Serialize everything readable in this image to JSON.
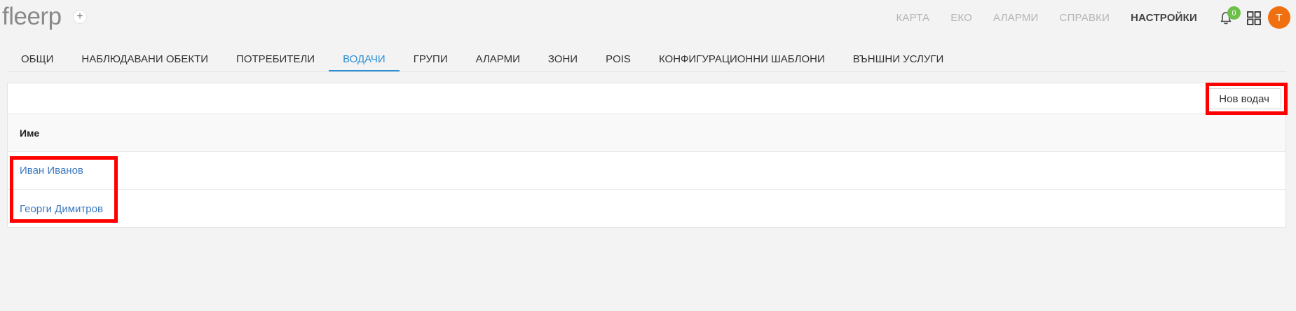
{
  "app": {
    "logo": "fleerp",
    "add_icon": "plus-icon"
  },
  "topnav": {
    "items": [
      {
        "label": "КАРТА",
        "active": false
      },
      {
        "label": "ЕКО",
        "active": false
      },
      {
        "label": "АЛАРМИ",
        "active": false
      },
      {
        "label": "СПРАВКИ",
        "active": false
      },
      {
        "label": "НАСТРОЙКИ",
        "active": true
      }
    ],
    "notifications_count": "0",
    "bell_icon": "bell-icon",
    "apps_icon": "grid-icon",
    "avatar_initial": "T",
    "avatar_color": "#f06f0e",
    "badge_color": "#6cc04a"
  },
  "tabs": {
    "items": [
      {
        "label": "ОБЩИ",
        "active": false
      },
      {
        "label": "НАБЛЮДАВАНИ ОБЕКТИ",
        "active": false
      },
      {
        "label": "ПОТРЕБИТЕЛИ",
        "active": false
      },
      {
        "label": "ВОДАЧИ",
        "active": true
      },
      {
        "label": "ГРУПИ",
        "active": false
      },
      {
        "label": "АЛАРМИ",
        "active": false
      },
      {
        "label": "ЗОНИ",
        "active": false
      },
      {
        "label": "POIS",
        "active": false
      },
      {
        "label": "КОНФИГУРАЦИОННИ ШАБЛОНИ",
        "active": false
      },
      {
        "label": "ВЪНШНИ УСЛУГИ",
        "active": false
      }
    ],
    "active_color": "#2b8fd6"
  },
  "toolbar": {
    "new_driver_label": "Нов водач"
  },
  "table": {
    "columns": [
      "Име"
    ],
    "rows": [
      {
        "name": "Иван Иванов"
      },
      {
        "name": "Георги Димитров"
      }
    ],
    "link_color": "#3a78c0"
  },
  "annotations": {
    "highlight_color": "#ff0000"
  }
}
